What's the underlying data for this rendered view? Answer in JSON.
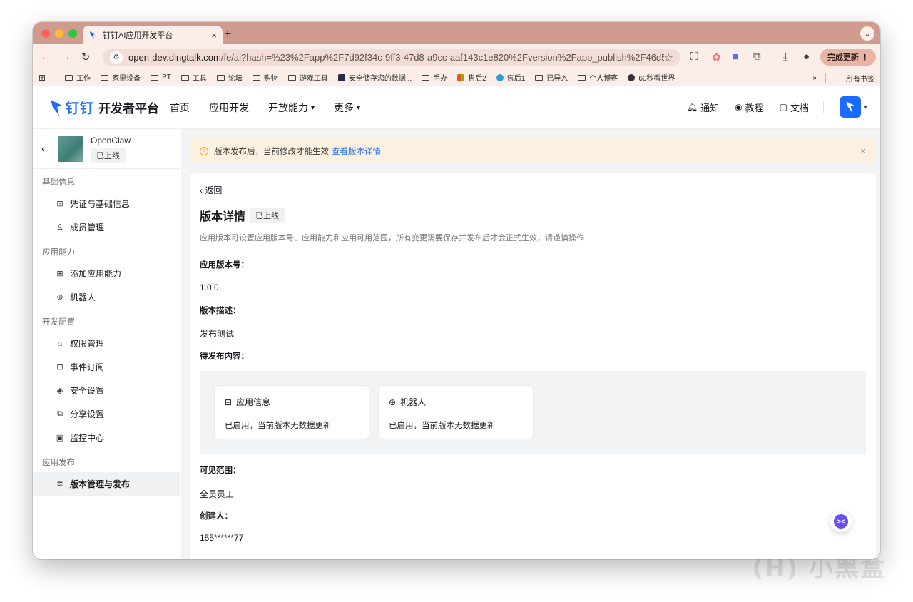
{
  "browser": {
    "tab_title": "钉钉AI应用开发平台",
    "tab_close": "×",
    "new_tab": "+",
    "url_host": "open-dev.dingtalk.com",
    "url_path": "/fe/ai?hash=%23%2Fapp%2F7d92f34c-9ff3-47d8-a9cc-aaf143c1e820%2Fversion%2Fapp_publish%2F46d5b2c...",
    "update_label": "完成更新 ⋮",
    "bookmarks": [
      "工作",
      "家里设备",
      "PT",
      "工具",
      "论坛",
      "购物",
      "游戏工具",
      "安全储存您的数据...",
      "手办",
      "售后2",
      "售后1",
      "已导入",
      "个人博客",
      "60秒看世界"
    ],
    "bookmarks_more": "»",
    "all_bookmarks": "所有书签"
  },
  "header": {
    "brand": "钉钉",
    "brand_suffix": "开发者平台",
    "nav": [
      "首页",
      "应用开发",
      "开放能力",
      "更多"
    ],
    "right": {
      "notify": "通知",
      "tutorial": "教程",
      "docs": "文档"
    }
  },
  "sidebar": {
    "app_name": "OpenClaw",
    "app_status": "已上线",
    "groups": [
      {
        "title": "基础信息",
        "items": [
          "凭证与基础信息",
          "成员管理"
        ]
      },
      {
        "title": "应用能力",
        "items": [
          "添加应用能力",
          "机器人"
        ]
      },
      {
        "title": "开发配置",
        "items": [
          "权限管理",
          "事件订阅",
          "安全设置",
          "分享设置",
          "监控中心"
        ]
      },
      {
        "title": "应用发布",
        "items": [
          "版本管理与发布"
        ]
      }
    ]
  },
  "notice": {
    "text": "版本发布后，当前修改才能生效",
    "link": "查看版本详情",
    "close": "×"
  },
  "detail": {
    "back": "返回",
    "title": "版本详情",
    "status": "已上线",
    "description": "应用版本可设置应用版本号、应用能力和应用可用范围，所有变更需要保存并发布后才会正式生效，请谨慎操作",
    "version_label": "应用版本号：",
    "version_value": "1.0.0",
    "desc_label": "版本描述：",
    "desc_value": "发布测试",
    "pending_label": "待发布内容：",
    "pending": [
      {
        "title": "应用信息",
        "body": "已启用，当前版本无数据更新"
      },
      {
        "title": "机器人",
        "body": "已启用，当前版本无数据更新"
      }
    ],
    "scope_label": "可见范围：",
    "scope_value": "全员员工",
    "creator_label": "创建人：",
    "creator_value": "155******77"
  },
  "watermark": "小黑盒"
}
